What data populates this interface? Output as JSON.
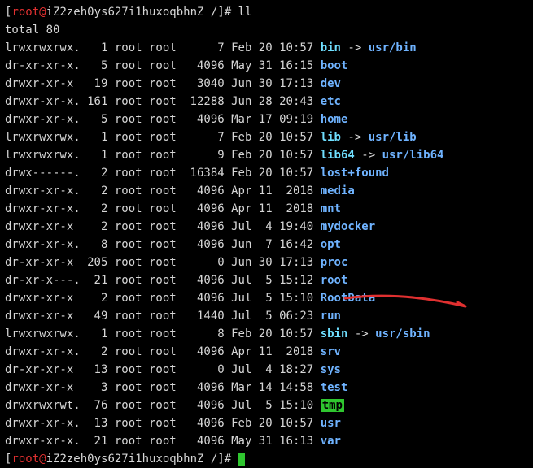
{
  "prompt": {
    "user": "root",
    "host": "iZ2zeh0ys627i1huxoqbhnZ",
    "path": "/",
    "command": "ll"
  },
  "total_line": "total 80",
  "rows": [
    {
      "perm": "lrwxrwxrwx.",
      "links": "1",
      "owner": "root",
      "group": "root",
      "size": "7",
      "date": "Feb 20 10:57",
      "name": "bin",
      "kind": "link",
      "target": "usr/bin"
    },
    {
      "perm": "dr-xr-xr-x.",
      "links": "5",
      "owner": "root",
      "group": "root",
      "size": "4096",
      "date": "May 31 16:15",
      "name": "boot",
      "kind": "dir"
    },
    {
      "perm": "drwxr-xr-x",
      "links": "19",
      "owner": "root",
      "group": "root",
      "size": "3040",
      "date": "Jun 30 17:13",
      "name": "dev",
      "kind": "dir"
    },
    {
      "perm": "drwxr-xr-x.",
      "links": "161",
      "owner": "root",
      "group": "root",
      "size": "12288",
      "date": "Jun 28 20:43",
      "name": "etc",
      "kind": "dir"
    },
    {
      "perm": "drwxr-xr-x.",
      "links": "5",
      "owner": "root",
      "group": "root",
      "size": "4096",
      "date": "Mar 17 09:19",
      "name": "home",
      "kind": "dir"
    },
    {
      "perm": "lrwxrwxrwx.",
      "links": "1",
      "owner": "root",
      "group": "root",
      "size": "7",
      "date": "Feb 20 10:57",
      "name": "lib",
      "kind": "link",
      "target": "usr/lib"
    },
    {
      "perm": "lrwxrwxrwx.",
      "links": "1",
      "owner": "root",
      "group": "root",
      "size": "9",
      "date": "Feb 20 10:57",
      "name": "lib64",
      "kind": "link",
      "target": "usr/lib64"
    },
    {
      "perm": "drwx------.",
      "links": "2",
      "owner": "root",
      "group": "root",
      "size": "16384",
      "date": "Feb 20 10:57",
      "name": "lost+found",
      "kind": "dir"
    },
    {
      "perm": "drwxr-xr-x.",
      "links": "2",
      "owner": "root",
      "group": "root",
      "size": "4096",
      "date": "Apr 11  2018",
      "name": "media",
      "kind": "dir"
    },
    {
      "perm": "drwxr-xr-x.",
      "links": "2",
      "owner": "root",
      "group": "root",
      "size": "4096",
      "date": "Apr 11  2018",
      "name": "mnt",
      "kind": "dir"
    },
    {
      "perm": "drwxr-xr-x",
      "links": "2",
      "owner": "root",
      "group": "root",
      "size": "4096",
      "date": "Jul  4 19:40",
      "name": "mydocker",
      "kind": "dir"
    },
    {
      "perm": "drwxr-xr-x.",
      "links": "8",
      "owner": "root",
      "group": "root",
      "size": "4096",
      "date": "Jun  7 16:42",
      "name": "opt",
      "kind": "dir"
    },
    {
      "perm": "dr-xr-xr-x",
      "links": "205",
      "owner": "root",
      "group": "root",
      "size": "0",
      "date": "Jun 30 17:13",
      "name": "proc",
      "kind": "dir"
    },
    {
      "perm": "dr-xr-x---.",
      "links": "21",
      "owner": "root",
      "group": "root",
      "size": "4096",
      "date": "Jul  5 15:12",
      "name": "root",
      "kind": "dir"
    },
    {
      "perm": "drwxr-xr-x",
      "links": "2",
      "owner": "root",
      "group": "root",
      "size": "4096",
      "date": "Jul  5 15:10",
      "name": "RootData",
      "kind": "dir"
    },
    {
      "perm": "drwxr-xr-x",
      "links": "49",
      "owner": "root",
      "group": "root",
      "size": "1440",
      "date": "Jul  5 06:23",
      "name": "run",
      "kind": "dir"
    },
    {
      "perm": "lrwxrwxrwx.",
      "links": "1",
      "owner": "root",
      "group": "root",
      "size": "8",
      "date": "Feb 20 10:57",
      "name": "sbin",
      "kind": "link",
      "target": "usr/sbin"
    },
    {
      "perm": "drwxr-xr-x.",
      "links": "2",
      "owner": "root",
      "group": "root",
      "size": "4096",
      "date": "Apr 11  2018",
      "name": "srv",
      "kind": "dir"
    },
    {
      "perm": "dr-xr-xr-x",
      "links": "13",
      "owner": "root",
      "group": "root",
      "size": "0",
      "date": "Jul  4 18:27",
      "name": "sys",
      "kind": "dir"
    },
    {
      "perm": "drwxr-xr-x",
      "links": "3",
      "owner": "root",
      "group": "root",
      "size": "4096",
      "date": "Mar 14 14:58",
      "name": "test",
      "kind": "dir"
    },
    {
      "perm": "drwxrwxrwt.",
      "links": "76",
      "owner": "root",
      "group": "root",
      "size": "4096",
      "date": "Jul  5 15:10",
      "name": "tmp",
      "kind": "tmp"
    },
    {
      "perm": "drwxr-xr-x.",
      "links": "13",
      "owner": "root",
      "group": "root",
      "size": "4096",
      "date": "Feb 20 10:57",
      "name": "usr",
      "kind": "dir"
    },
    {
      "perm": "drwxr-xr-x.",
      "links": "21",
      "owner": "root",
      "group": "root",
      "size": "4096",
      "date": "May 31 16:13",
      "name": "var",
      "kind": "dir"
    }
  ]
}
